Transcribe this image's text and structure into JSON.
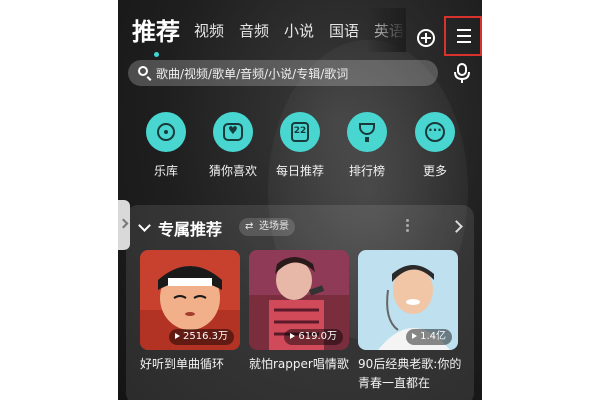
{
  "tabs": {
    "active": "推荐",
    "items": [
      "视频",
      "音频",
      "小说",
      "国语",
      "英语"
    ]
  },
  "search": {
    "placeholder": "歌曲/视频/歌单/音频/小说/专辑/歌词"
  },
  "quick_actions": [
    {
      "label": "乐库",
      "icon": "disc-icon"
    },
    {
      "label": "猜你喜欢",
      "icon": "heart-box-icon"
    },
    {
      "label": "每日推荐",
      "icon": "calendar-icon",
      "day": "22"
    },
    {
      "label": "排行榜",
      "icon": "trophy-icon"
    },
    {
      "label": "更多",
      "icon": "more-icon"
    }
  ],
  "section": {
    "title": "专属推荐",
    "scene_label": "选场景"
  },
  "playlists": [
    {
      "plays": "2516.3万",
      "title": "好听到单曲循环"
    },
    {
      "plays": "619.0万",
      "title": "就怕rapper唱情歌"
    },
    {
      "plays": "1.4亿",
      "title": "90后经典老歌:你的青春一直都在"
    }
  ],
  "colors": {
    "accent": "#49d6d0",
    "highlight_border": "#d9312b"
  }
}
